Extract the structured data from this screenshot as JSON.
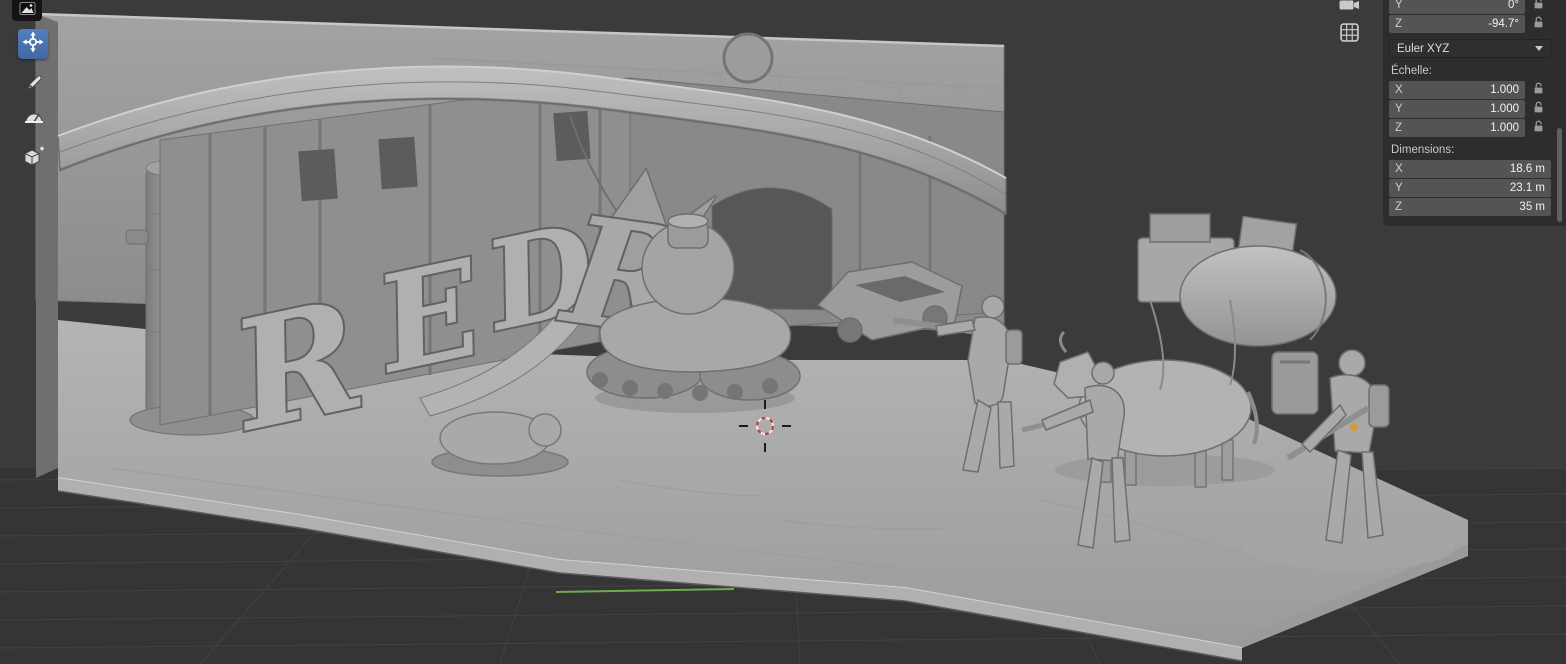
{
  "colors": {
    "active_tool_accent": "#4772b3",
    "axis_y_green": "#6cac50",
    "cursor_red": "#c23a3a",
    "soldier_marker_orange": "#d6973a"
  },
  "toolbar": {
    "tools": [
      {
        "name": "editor-type",
        "icon": "image-editor-icon",
        "active": false
      },
      {
        "name": "move",
        "icon": "move-gizmo-icon",
        "active": true
      },
      {
        "name": "annotate",
        "icon": "pencil-icon",
        "active": false
      },
      {
        "name": "measure",
        "icon": "protractor-icon",
        "active": false
      },
      {
        "name": "add-cube",
        "icon": "cube-icon",
        "active": false
      }
    ]
  },
  "viewport": {
    "overlay_icons": [
      {
        "name": "camera-icon"
      },
      {
        "name": "grid-icon"
      }
    ],
    "markers": [
      "3d-cursor"
    ]
  },
  "scene": {
    "letters": [
      "R",
      "E",
      "D"
    ],
    "partial_letter": "R"
  },
  "panel": {
    "rotation": {
      "rows": [
        {
          "axis": "Y",
          "value": "0°"
        },
        {
          "axis": "Z",
          "value": "-94.7°"
        }
      ],
      "mode": "Euler XYZ"
    },
    "scale": {
      "label": "Échelle:",
      "rows": [
        {
          "axis": "X",
          "value": "1.000"
        },
        {
          "axis": "Y",
          "value": "1.000"
        },
        {
          "axis": "Z",
          "value": "1.000"
        }
      ]
    },
    "dimensions": {
      "label": "Dimensions:",
      "rows": [
        {
          "axis": "X",
          "value": "18.6 m"
        },
        {
          "axis": "Y",
          "value": "23.1 m"
        },
        {
          "axis": "Z",
          "value": "35 m"
        }
      ]
    }
  }
}
